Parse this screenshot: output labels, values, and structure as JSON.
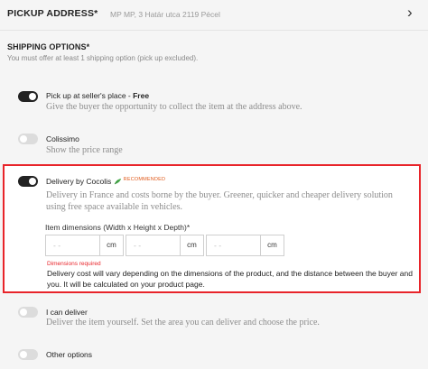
{
  "pickup_address": {
    "label": "PICKUP ADDRESS*",
    "value": "MP MP, 3 Határ utca 2119 Pécel",
    "chevron_icon": "chevron-right-icon"
  },
  "shipping": {
    "title": "SHIPPING OPTIONS*",
    "subtitle": "You must offer at least 1 shipping option (pick up excluded).",
    "options": [
      {
        "title": "Pick up at seller's place - ",
        "title_bold": "Free",
        "description": "Give the buyer the opportunity to collect the item at the address above.",
        "enabled": true
      },
      {
        "title": "Colissimo",
        "description": "Show the price range",
        "enabled": false
      },
      {
        "title": "Delivery by Cocolis",
        "badge": "RECOMMENDED",
        "icon": "leaf-icon",
        "description_line1": "Delivery in France and costs borne by the buyer. Greener, quicker and cheaper delivery solution",
        "description_line2": "using free space available in vehicles.",
        "enabled": true,
        "dimensions_label": "Item dimensions (Width x Height x Depth)*",
        "dimensions": [
          {
            "placeholder": "- -",
            "unit": "cm"
          },
          {
            "placeholder": "- -",
            "unit": "cm"
          },
          {
            "placeholder": "- -",
            "unit": "cm"
          }
        ],
        "error": "Dimensions required",
        "note": "Delivery cost will vary depending on the dimensions of the product, and the distance between the buyer and you. It will be calculated on your product page."
      },
      {
        "title": "I can deliver",
        "description": "Deliver the item yourself. Set the area you can deliver and choose the price.",
        "enabled": false
      },
      {
        "title": "Other options",
        "enabled": false
      }
    ]
  },
  "colors": {
    "accent_red": "#e8242a",
    "badge_orange": "#e05a1b",
    "leaf_green": "#4caf50"
  }
}
